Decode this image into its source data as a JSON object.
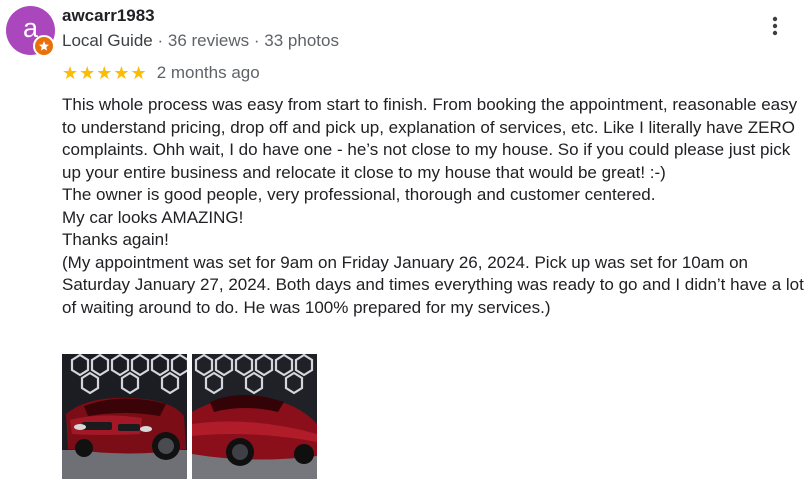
{
  "reviewer": {
    "avatar_letter": "a",
    "avatar_color": "#ab47bc",
    "badge_color": "#e8710a",
    "name": "awcarr1983",
    "guide_label": "Local Guide",
    "reviews_count": "36 reviews",
    "photos_count": "33 photos",
    "separator": "·"
  },
  "review": {
    "rating": 5,
    "stars": "★★★★★",
    "star_color": "#fbbc04",
    "time_ago": "2 months ago",
    "paragraphs": [
      "This whole process was easy from start to finish. From booking the appointment, reasonable easy to understand pricing, drop off and pick up, explanation of services, etc. Like I literally have ZERO complaints. Ohh wait, I do have one - he’s not close to my house. So if you could please just pick up your entire business and relocate it close to my house that would be great! :-)",
      "The owner is good people, very professional, thorough and customer centered.",
      "My car looks AMAZING!",
      "Thanks again!",
      "(My appointment was set for 9am on Friday January 26, 2024. Pick up was set for 10am on Saturday January 27, 2024. Both days and times everything was ready to go and I didn’t have a lot of waiting around to do. He was 100% prepared for my services.)"
    ]
  },
  "photos": [
    {
      "name": "front-view-red-car"
    },
    {
      "name": "side-view-red-car"
    }
  ],
  "menu": {
    "icon": "more-vert-icon"
  }
}
